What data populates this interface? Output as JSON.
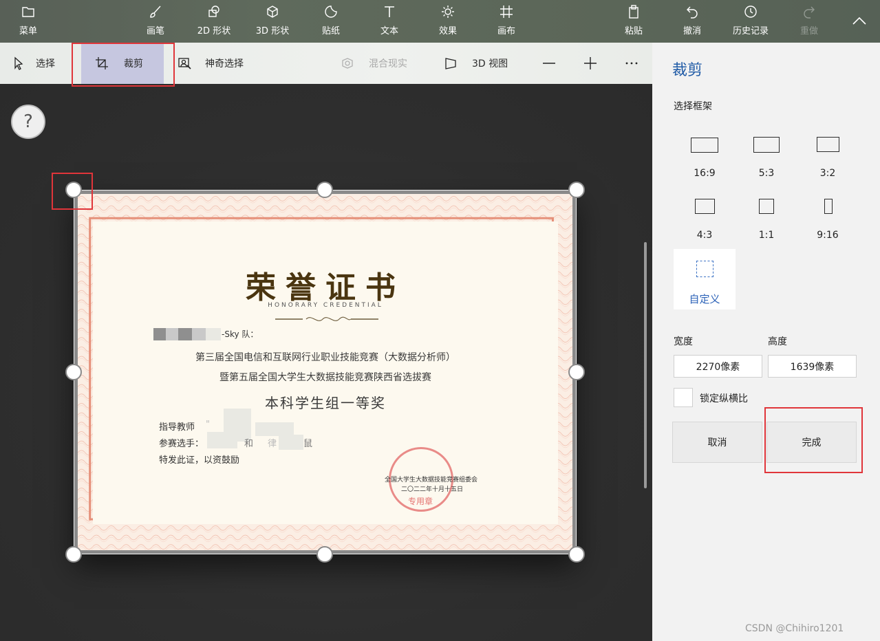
{
  "toolbar": {
    "menu": "菜单",
    "brush": "画笔",
    "shapes2d": "2D 形状",
    "shapes3d": "3D 形状",
    "stickers": "贴纸",
    "text": "文本",
    "effects": "效果",
    "canvas": "画布",
    "paste": "粘贴",
    "undo": "撤消",
    "history": "历史记录",
    "redo": "重做"
  },
  "subtoolbar": {
    "select": "选择",
    "crop": "裁剪",
    "magic_select": "神奇选择",
    "mixed_reality": "混合现实",
    "view3d": "3D 视图"
  },
  "canvas": {
    "help": "?"
  },
  "certificate": {
    "title": "荣誉证书",
    "subtitle": "HONORARY CREDENTIAL",
    "team_suffix": "-Sky 队：",
    "line1": "第三届全国电信和互联网行业职业技能竞赛（大数据分析师）",
    "line2": "暨第五届全国大学生大数据技能竞赛陕西省选拔赛",
    "award": "本科学生组一等奖",
    "teacher_label": "指导教师",
    "participants_label": "参赛选手：",
    "teacher_value_fragment": "\"",
    "participant_fragment_1": "和",
    "participant_fragment_2": "律",
    "participant_fragment_3": "鼠",
    "closing": "特发此证，以资鼓励",
    "issuer": "全国大学生大数据技能竞赛组委会",
    "date": "二〇二二年十月十五日",
    "seal_text": "专用章"
  },
  "panel": {
    "title": "裁剪",
    "frame_label": "选择框架",
    "ratios": [
      "16:9",
      "5:3",
      "3:2",
      "4:3",
      "1:1",
      "9:16"
    ],
    "custom": "自定义",
    "width_label": "宽度",
    "height_label": "高度",
    "width_value": "2270像素",
    "height_value": "1639像素",
    "lock_label": "锁定纵横比",
    "cancel": "取消",
    "done": "完成"
  },
  "watermark": "CSDN @Chihiro1201",
  "colors": {
    "accent_blue": "#1f5aa6",
    "highlight_red": "#e0353a",
    "selected_tool": "#c6c7e0"
  }
}
